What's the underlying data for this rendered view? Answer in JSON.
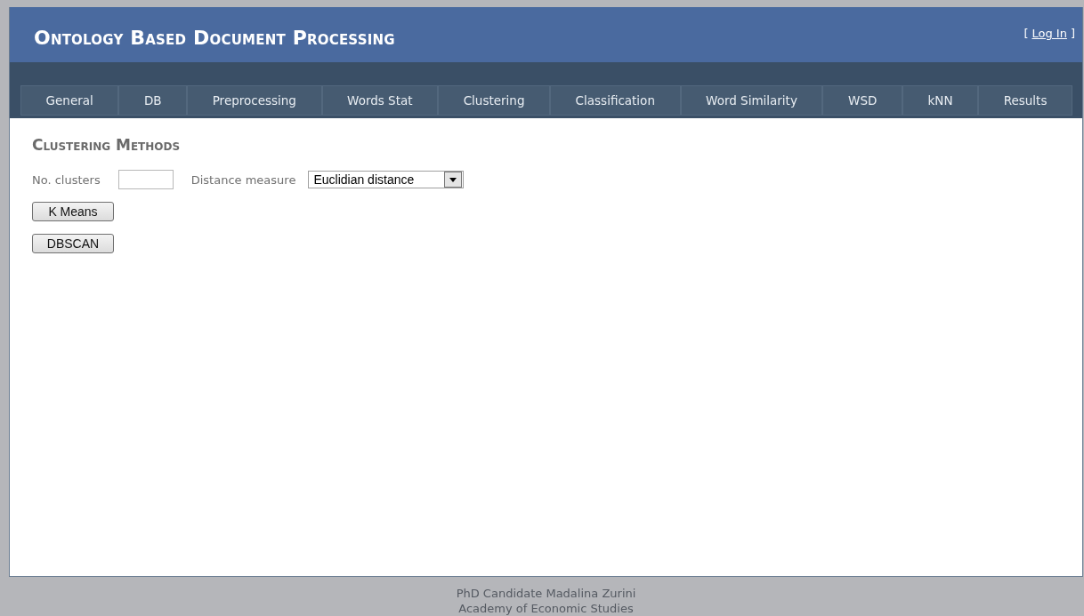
{
  "header": {
    "title": "Ontology Based Document Processing",
    "login": {
      "open": "[",
      "link": "Log In",
      "close": "]"
    }
  },
  "tabs": [
    "General",
    "DB",
    "Preprocessing",
    "Words Stat",
    "Clustering",
    "Classification",
    "Word Similarity",
    "WSD",
    "kNN",
    "Results"
  ],
  "section": {
    "title": "Clustering Methods",
    "clusters_label": "No. clusters",
    "distance_label": "Distance measure",
    "distance_value": "Euclidian distance",
    "buttons": [
      "K Means",
      "DBSCAN"
    ]
  },
  "footer": [
    "PhD Candidate Madalina Zurini",
    "Academy of Economic Studies"
  ]
}
